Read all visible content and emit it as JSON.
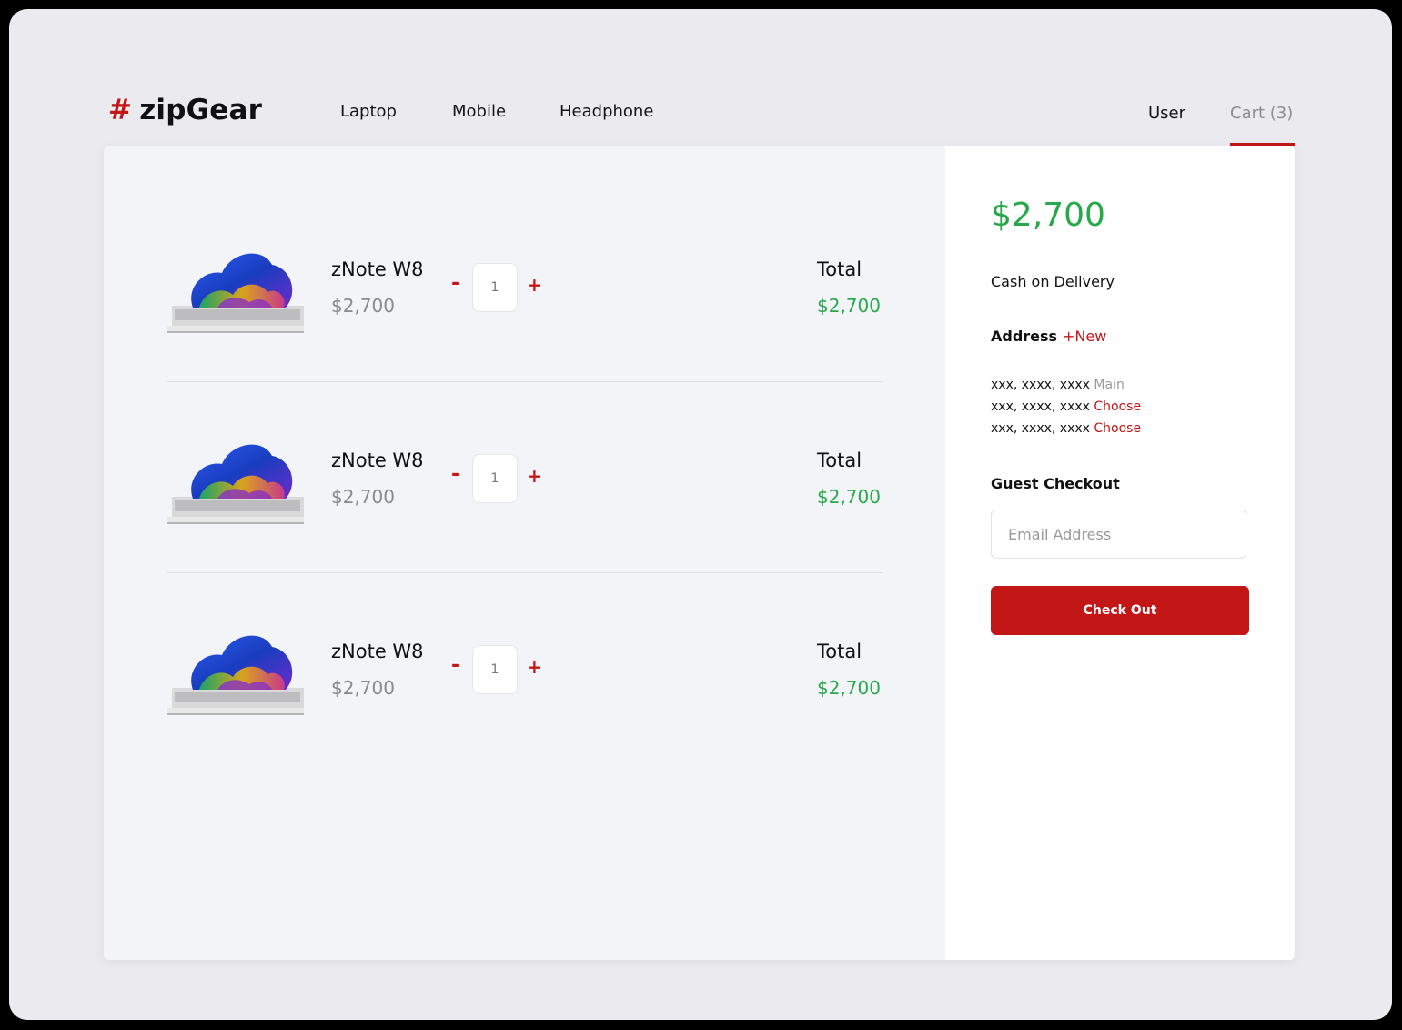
{
  "brand": {
    "hash": "#",
    "name": "zipGear"
  },
  "nav": {
    "items": [
      {
        "label": "Laptop"
      },
      {
        "label": "Mobile"
      },
      {
        "label": "Headphone"
      }
    ],
    "user": "User",
    "cart": "Cart (3)"
  },
  "cart": {
    "items": [
      {
        "name": "zNote W8",
        "price": "$2,700",
        "qty": "1",
        "minus": "-",
        "plus": "+",
        "total_label": "Total",
        "total": "$2,700",
        "image": "laptop-image"
      },
      {
        "name": "zNote W8",
        "price": "$2,700",
        "qty": "1",
        "minus": "-",
        "plus": "+",
        "total_label": "Total",
        "total": "$2,700",
        "image": "laptop-image"
      },
      {
        "name": "zNote W8",
        "price": "$2,700",
        "qty": "1",
        "minus": "-",
        "plus": "+",
        "total_label": "Total",
        "total": "$2,700",
        "image": "laptop-image"
      }
    ]
  },
  "summary": {
    "total": "$2,700",
    "payment_method": "Cash on Delivery",
    "address_label": "Address",
    "address_new": "+New",
    "addresses": [
      {
        "text": "xxx, xxxx, xxxx",
        "tag": "Main"
      },
      {
        "text": "xxx, xxxx, xxxx",
        "tag": "Choose"
      },
      {
        "text": "xxx, xxxx, xxxx",
        "tag": "Choose"
      }
    ],
    "guest_label": "Guest Checkout",
    "email_placeholder": "Email Address",
    "email_value": "",
    "checkout_label": "Check Out"
  },
  "colors": {
    "accent": "#c31616",
    "price_green": "#27a84a",
    "muted": "#8a8a8a"
  }
}
